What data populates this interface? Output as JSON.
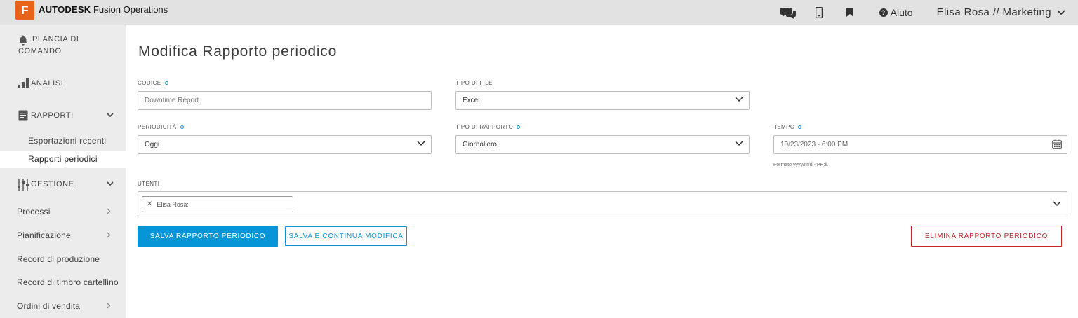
{
  "header": {
    "logo_letter": "F",
    "brand_bold": "AUTODESK",
    "brand_rest": "Fusion Operations",
    "help_label": "Aiuto",
    "user_label": "Elisa Rosa // Marketing",
    "icons": [
      "chat-icon",
      "mobile-icon",
      "bookmark-icon",
      "help-icon",
      "chevron-down-icon"
    ]
  },
  "sidebar": {
    "dashboard_line1": "PLANCIA DI",
    "dashboard_line2": "COMANDO",
    "analysis": "ANALISI",
    "reports": "RAPPORTI",
    "reports_sub": [
      "Esportazioni recenti",
      "Rapporti periodici"
    ],
    "management": "GESTIONE",
    "items": [
      "Processi",
      "Pianificazione",
      "Record di produzione",
      "Record di timbro cartellino",
      "Ordini di vendita"
    ]
  },
  "main": {
    "title": "Modifica Rapporto periodico",
    "code": {
      "label": "CODICE",
      "placeholder": "Downtime Report"
    },
    "file_type": {
      "label": "TIPO DI FILE",
      "value": "Excel"
    },
    "periodicity": {
      "label": "PERIODICITÀ",
      "value": "Oggi"
    },
    "report_type": {
      "label": "TIPO DI RAPPORTO",
      "value": "Giornaliero"
    },
    "time": {
      "label": "TEMPO",
      "value": "10/23/2023 - 6:00 PM",
      "hint": "Formato yyyy/m/d - PH:ii."
    },
    "users": {
      "label": "UTENTI",
      "chip": "Elisa Rosa:"
    },
    "buttons": {
      "save": "SALVA RAPPORTO PERIODICO",
      "save_continue": "SALVA E CONTINUA MODIFICA",
      "delete": "ELIMINA RAPPORTO PERIODICO"
    }
  },
  "colors": {
    "accent": "#0696d7",
    "danger": "#c1272d",
    "brand": "#e8621a"
  }
}
